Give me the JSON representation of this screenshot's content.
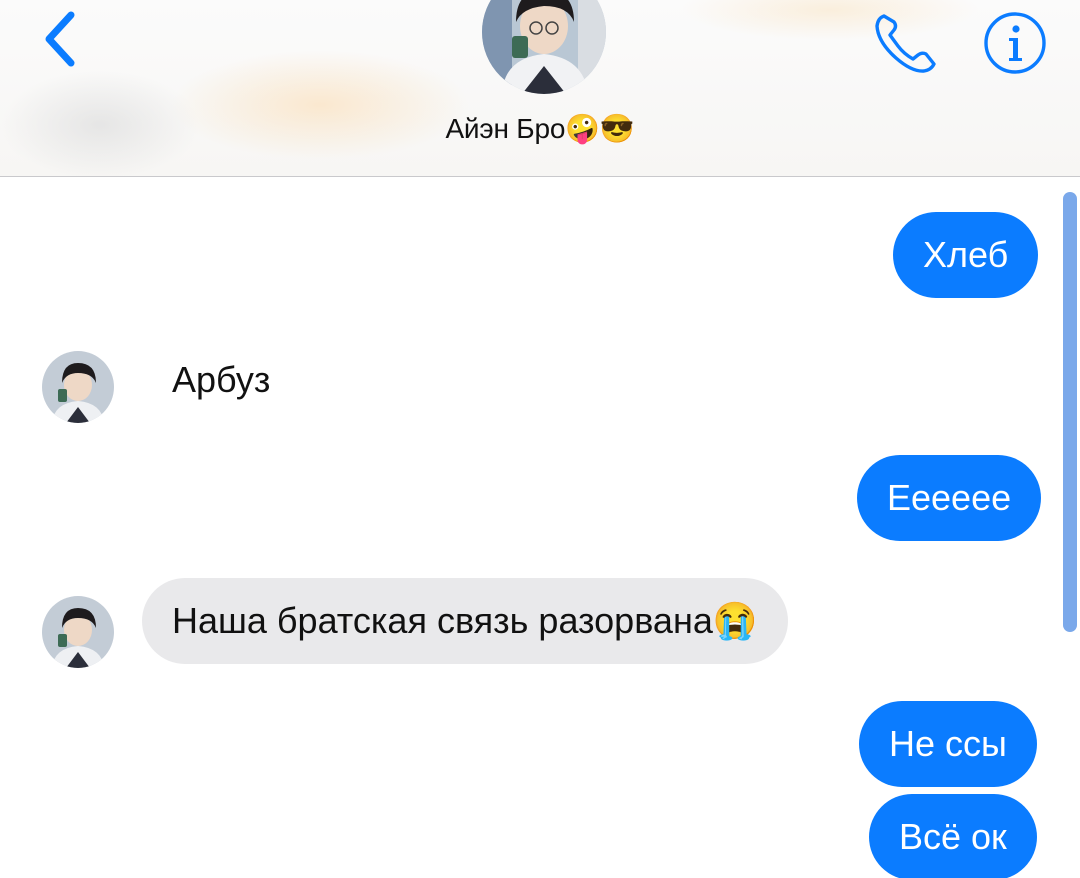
{
  "header": {
    "contact_name": "Айэн Бро🤪😎",
    "back_icon": "chevron-left-icon",
    "call_icon": "phone-icon",
    "info_icon": "info-icon",
    "accent_color": "#0b7cff"
  },
  "messages": [
    {
      "direction": "outgoing",
      "text": "Хлеб"
    },
    {
      "direction": "incoming",
      "text": "Арбуз",
      "style": "emoji-sized plain"
    },
    {
      "direction": "outgoing",
      "text": "Eeeeee"
    },
    {
      "direction": "incoming",
      "text": "Наша братская связь разорвана😭"
    },
    {
      "direction": "outgoing",
      "text": "Не ссы"
    },
    {
      "direction": "outgoing",
      "text": "Всё ок"
    }
  ],
  "colors": {
    "outgoing_bubble": "#0b7cff",
    "incoming_bubble": "#e9e9eb",
    "scrollbar": "#7aa8ea"
  }
}
